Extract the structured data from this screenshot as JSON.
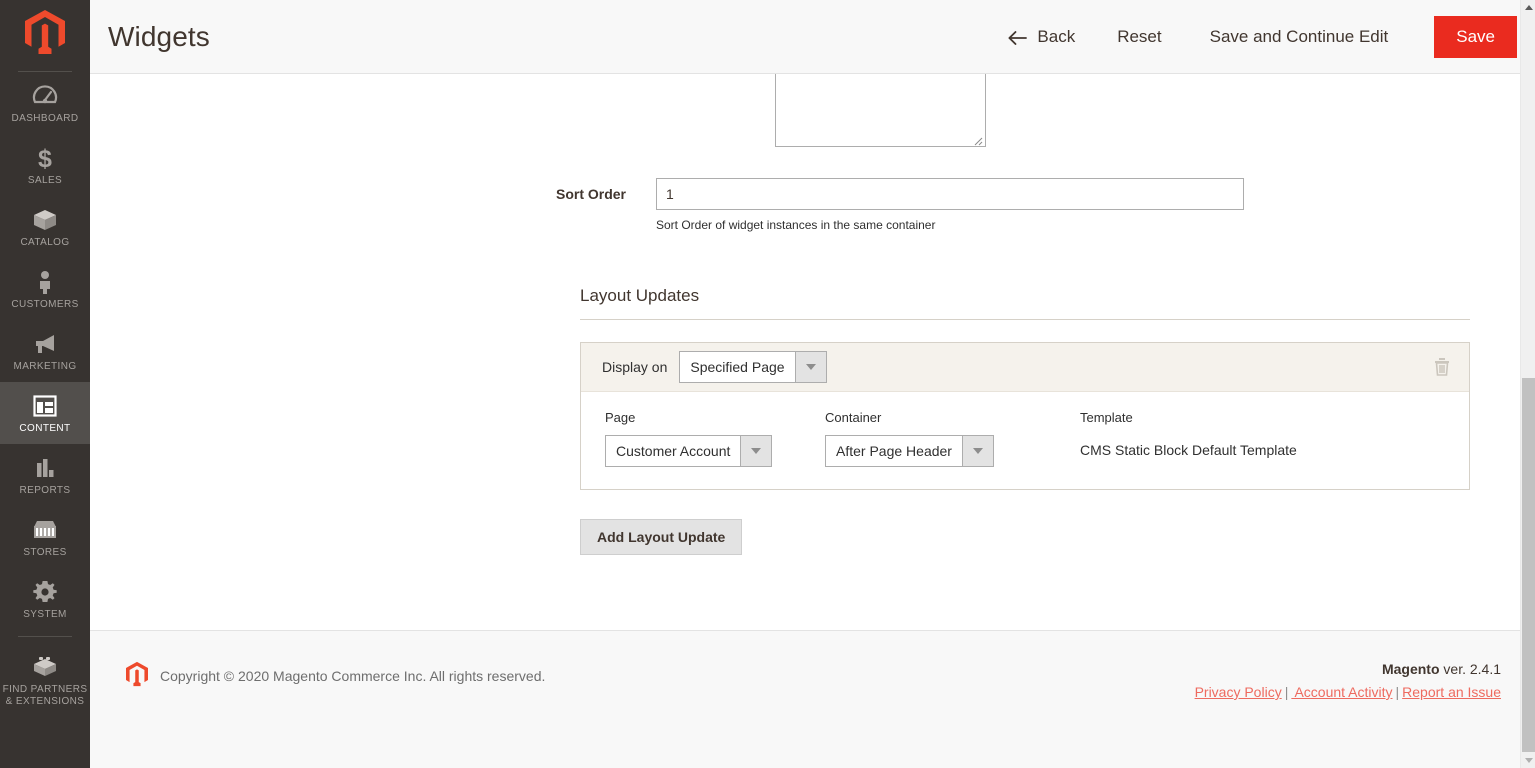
{
  "sidebar": {
    "logo": "magento-logo",
    "items": [
      {
        "label": "DASHBOARD",
        "icon": "dashboard-icon",
        "active": false
      },
      {
        "label": "SALES",
        "icon": "dollar-icon",
        "active": false
      },
      {
        "label": "CATALOG",
        "icon": "box-icon",
        "active": false
      },
      {
        "label": "CUSTOMERS",
        "icon": "person-icon",
        "active": false
      },
      {
        "label": "MARKETING",
        "icon": "megaphone-icon",
        "active": false
      },
      {
        "label": "CONTENT",
        "icon": "layout-icon",
        "active": true
      },
      {
        "label": "REPORTS",
        "icon": "bar-chart-icon",
        "active": false
      },
      {
        "label": "STORES",
        "icon": "storefront-icon",
        "active": false
      },
      {
        "label": "SYSTEM",
        "icon": "gear-icon",
        "active": false
      },
      {
        "label": "FIND PARTNERS & EXTENSIONS",
        "icon": "blocks-icon",
        "active": false
      }
    ]
  },
  "header": {
    "title": "Widgets",
    "back_label": "Back",
    "reset_label": "Reset",
    "save_continue_label": "Save and Continue Edit",
    "save_label": "Save"
  },
  "form": {
    "sort_order": {
      "label": "Sort Order",
      "value": "1",
      "note": "Sort Order of widget instances in the same container"
    }
  },
  "layout_updates": {
    "section_title": "Layout Updates",
    "display_on": {
      "label": "Display on",
      "value": "Specified Page"
    },
    "columns": {
      "page_label": "Page",
      "page_value": "Customer Account",
      "container_label": "Container",
      "container_value": "After Page Header",
      "template_label": "Template",
      "template_value": "CMS Static Block Default Template"
    },
    "delete_icon": "trash-icon",
    "add_button_label": "Add Layout Update"
  },
  "footer": {
    "copyright": "Copyright © 2020 Magento Commerce Inc. All rights reserved.",
    "brand": "Magento",
    "version": " ver. 2.4.1",
    "links": [
      {
        "label": "Privacy Policy"
      },
      {
        "label": " Account Activity"
      },
      {
        "label": "Report an Issue"
      }
    ],
    "separator": "|"
  },
  "colors": {
    "accent_red": "#ea2b1f",
    "sidebar_bg": "#373330",
    "link_red": "#ee6a5f",
    "panel_beige": "#f5f2ec"
  }
}
